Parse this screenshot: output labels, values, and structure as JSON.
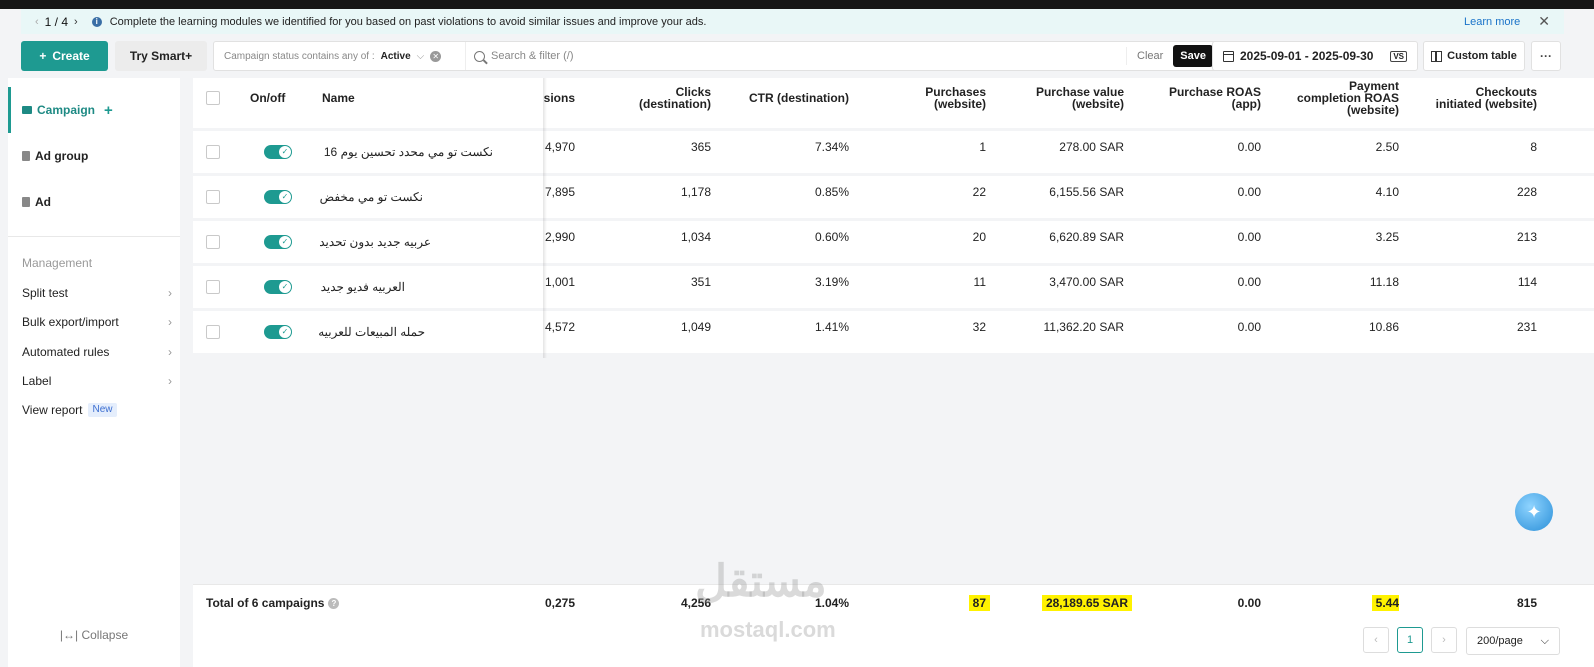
{
  "notice": {
    "pager": "1 / 4",
    "message": "Complete the learning modules we identified for you based on past violations to avoid similar issues and improve your ads.",
    "learn_more": "Learn more"
  },
  "toolbar": {
    "create_label": "Create",
    "smart_label": "Try Smart+",
    "filter_prefix": "Campaign status contains any of :",
    "filter_value": "Active",
    "search_placeholder": "Search & filter (/)",
    "clear_label": "Clear",
    "save_label": "Save",
    "date_range": "2025-09-01 - 2025-09-30",
    "compare_label": "VS",
    "custom_table_label": "Custom table",
    "more_label": "···"
  },
  "sidebar": {
    "levels": [
      "Campaign",
      "Ad group",
      "Ad"
    ],
    "management_title": "Management",
    "management_items": [
      "Split test",
      "Bulk export/import",
      "Automated rules",
      "Label",
      "View report"
    ],
    "new_badge": "New",
    "collapse_label": "Collapse"
  },
  "table": {
    "headers": {
      "onoff": "On/off",
      "name": "Name",
      "impressions": "sions",
      "clicks": [
        "Clicks",
        "(destination)"
      ],
      "ctr": "CTR (destination)",
      "purchases": [
        "Purchases",
        "(website)"
      ],
      "purchase_value": [
        "Purchase value",
        "(website)"
      ],
      "roas_app": [
        "Purchase ROAS",
        "(app)"
      ],
      "payment_roas": [
        "Payment",
        "completion ROAS",
        "(website)"
      ],
      "checkouts": [
        "Checkouts",
        "initiated (website)"
      ]
    },
    "rows": [
      {
        "name": "نكست تو مي محدد تحسين يوم 16",
        "impressions": "4,970",
        "clicks": "365",
        "ctr": "7.34%",
        "purchases": "1",
        "purchase_value": "278.00 SAR",
        "roas_app": "0.00",
        "payment_roas": "2.50",
        "checkouts": "8"
      },
      {
        "name": "نكست تو مي مخفض",
        "impressions": "7,895",
        "clicks": "1,178",
        "ctr": "0.85%",
        "purchases": "22",
        "purchase_value": "6,155.56 SAR",
        "roas_app": "0.00",
        "payment_roas": "4.10",
        "checkouts": "228"
      },
      {
        "name": "عربيه جديد بدون تحديد",
        "impressions": "2,990",
        "clicks": "1,034",
        "ctr": "0.60%",
        "purchases": "20",
        "purchase_value": "6,620.89 SAR",
        "roas_app": "0.00",
        "payment_roas": "3.25",
        "checkouts": "213"
      },
      {
        "name": "العربيه فديو جديد",
        "impressions": "1,001",
        "clicks": "351",
        "ctr": "3.19%",
        "purchases": "11",
        "purchase_value": "3,470.00 SAR",
        "roas_app": "0.00",
        "payment_roas": "11.18",
        "checkouts": "114"
      },
      {
        "name": "حمله المبيعات للعربيه",
        "impressions": "4,572",
        "clicks": "1,049",
        "ctr": "1.41%",
        "purchases": "32",
        "purchase_value": "11,362.20 SAR",
        "roas_app": "0.00",
        "payment_roas": "10.86",
        "checkouts": "231"
      }
    ],
    "totals": {
      "label": "Total of 6 campaigns",
      "impressions": "0,275",
      "clicks": "4,256",
      "ctr": "1.04%",
      "purchases": "87",
      "purchase_value": "28,189.65 SAR",
      "roas_app": "0.00",
      "payment_roas": "5.44",
      "checkouts": "815"
    }
  },
  "pagination": {
    "current_page": "1",
    "per_page": "200/page"
  },
  "watermark": {
    "arabic": "مستقل",
    "latin": "mostaql.com"
  },
  "colors": {
    "accent": "#1e9a91",
    "highlight": "#fff200",
    "notice_bg": "#e9f7f7"
  }
}
